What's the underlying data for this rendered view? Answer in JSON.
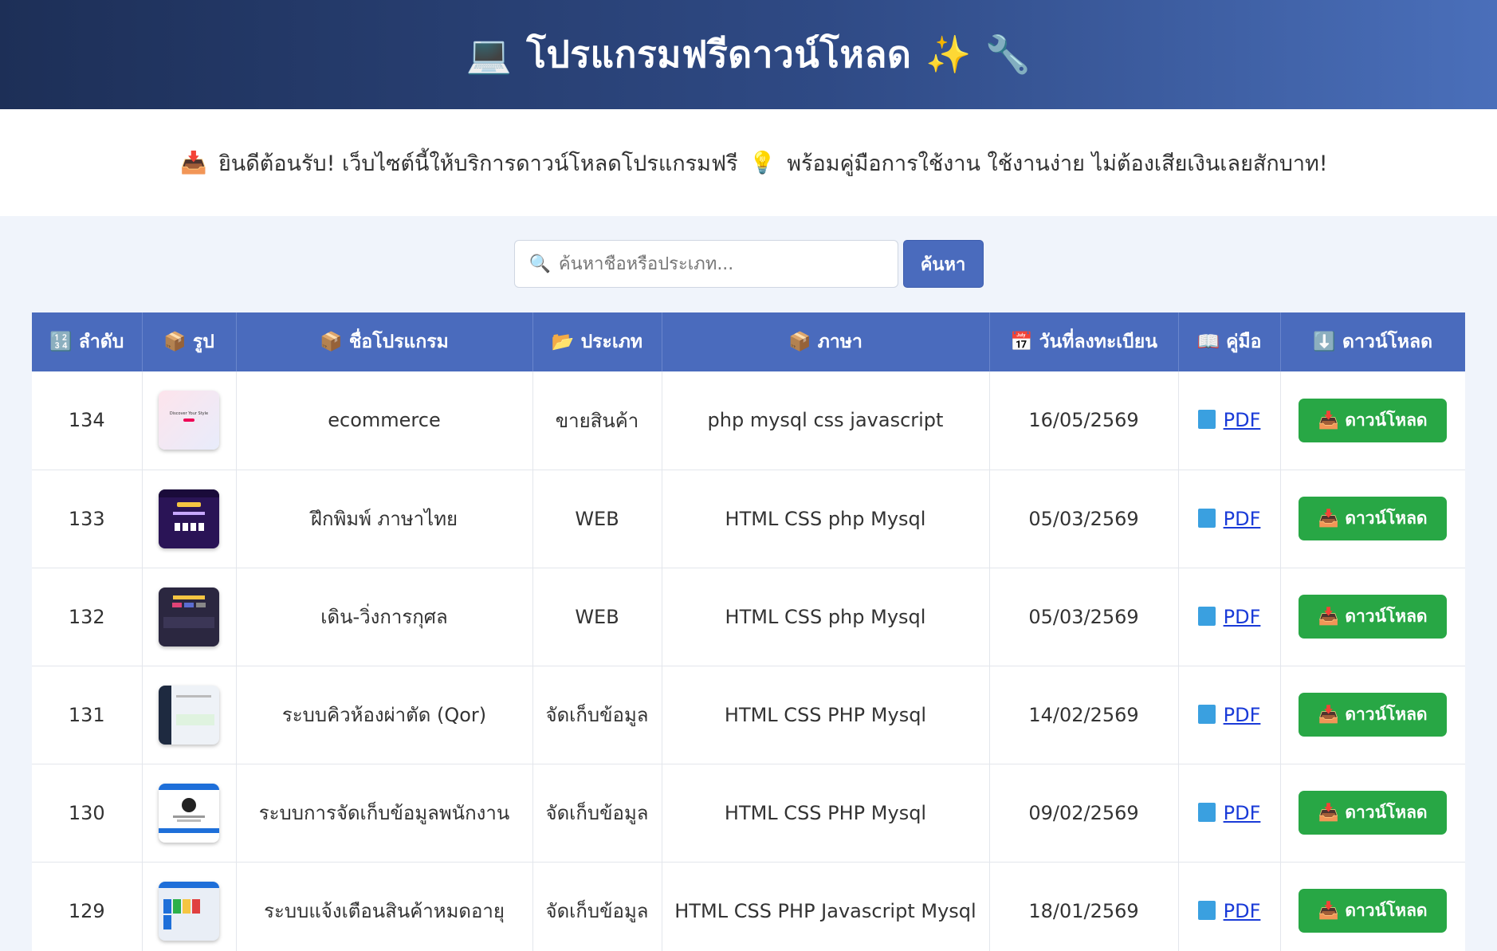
{
  "header": {
    "icon_left": "💻",
    "title": "โปรแกรมฟรีดาวน์โหลด",
    "icon_right": "✨ 🔧"
  },
  "welcome": {
    "icon1": "📥",
    "text1": "ยินดีต้อนรับ! เว็บไซต์นี้ให้บริการดาวน์โหลดโปรแกรมฟรี",
    "icon2": "💡",
    "text2": "พร้อมคู่มือการใช้งาน ใช้งานง่าย ไม่ต้องเสียเงินเลยสักบาท!"
  },
  "search": {
    "icon": "🔍",
    "placeholder": "ค้นหาชื่อหรือประเภท...",
    "button_label": "ค้นหา"
  },
  "table": {
    "headers": [
      {
        "icon": "🔢",
        "label": "ลำดับ"
      },
      {
        "icon": "📦",
        "label": "รูป"
      },
      {
        "icon": "📦",
        "label": "ชื่อโปรแกรม"
      },
      {
        "icon": "📂",
        "label": "ประเภท"
      },
      {
        "icon": "📦",
        "label": "ภาษา"
      },
      {
        "icon": "📅",
        "label": "วันที่ลงทะเบียน"
      },
      {
        "icon": "📖",
        "label": "คู่มือ"
      },
      {
        "icon": "⬇️",
        "label": "ดาวน์โหลด"
      }
    ],
    "rows": [
      {
        "no": "134",
        "name": "ecommerce",
        "category": "ขายสินค้า",
        "lang": "php mysql css javascript",
        "date": "16/05/2569",
        "manual": "PDF",
        "download": "📥 ดาวน์โหลด",
        "thumb_bg": "#fde4ec",
        "thumb_text": "Discover Your Style"
      },
      {
        "no": "133",
        "name": "ฝึกพิมพ์ ภาษาไทย",
        "category": "WEB",
        "lang": "HTML CSS php Mysql",
        "date": "05/03/2569",
        "manual": "PDF",
        "download": "📥 ดาวน์โหลด",
        "thumb_bg": "#2a1456",
        "thumb_text": ""
      },
      {
        "no": "132",
        "name": "เดิน-วิ่งการกุศล",
        "category": "WEB",
        "lang": "HTML CSS php Mysql",
        "date": "05/03/2569",
        "manual": "PDF",
        "download": "📥 ดาวน์โหลด",
        "thumb_bg": "#2b2740",
        "thumb_text": ""
      },
      {
        "no": "131",
        "name": "ระบบคิวห้องผ่าตัด (Qor)",
        "category": "จัดเก็บข้อมูล",
        "lang": "HTML CSS PHP Mysql",
        "date": "14/02/2569",
        "manual": "PDF",
        "download": "📥 ดาวน์โหลด",
        "thumb_bg": "#eef2f7",
        "thumb_text": ""
      },
      {
        "no": "130",
        "name": "ระบบการจัดเก็บข้อมูลพนักงาน",
        "category": "จัดเก็บข้อมูล",
        "lang": "HTML CSS PHP Mysql",
        "date": "09/02/2569",
        "manual": "PDF",
        "download": "📥 ดาวน์โหลด",
        "thumb_bg": "#ffffff",
        "thumb_text": ""
      },
      {
        "no": "129",
        "name": "ระบบแจ้งเตือนสินค้าหมดอายุ",
        "category": "จัดเก็บข้อมูล",
        "lang": "HTML CSS PHP Javascript Mysql",
        "date": "18/01/2569",
        "manual": "PDF",
        "download": "📥 ดาวน์โหลด",
        "thumb_bg": "#e9eef6",
        "thumb_text": ""
      }
    ]
  },
  "colors": {
    "header_dark": "#1d2f57",
    "header_light": "#4a6fba",
    "table_header": "#4a6bbd",
    "download_btn": "#28a745",
    "link": "#1a3bd8"
  }
}
